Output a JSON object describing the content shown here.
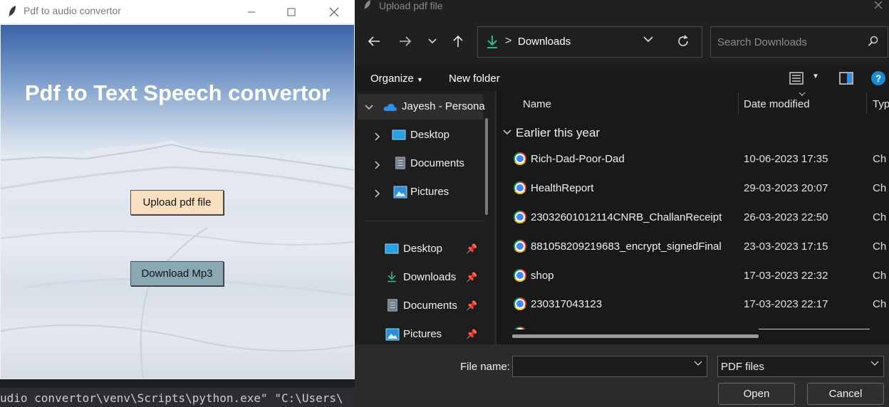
{
  "tk_window": {
    "title": "Pdf to audio convertor",
    "heading": "Pdf to Text Speech convertor",
    "upload_button": "Upload pdf file",
    "download_button": "Download Mp3"
  },
  "terminal": {
    "text": "udio convertor\\venv\\Scripts\\python.exe\" \"C:\\Users\\"
  },
  "dialog": {
    "title": "Upload pdf file",
    "address": {
      "sep": ">",
      "location": "Downloads"
    },
    "search_placeholder": "Search Downloads",
    "toolbar": {
      "organize": "Organize",
      "new_folder": "New folder",
      "help": "?"
    },
    "nav": {
      "account": "Jayesh - Persona",
      "tree": [
        "Desktop",
        "Documents",
        "Pictures"
      ],
      "quick": [
        "Desktop",
        "Downloads",
        "Documents",
        "Pictures"
      ]
    },
    "columns": {
      "name": "Name",
      "date": "Date modified",
      "type": "Typ"
    },
    "group": "Earlier this year",
    "files": [
      {
        "name": "Rich-Dad-Poor-Dad",
        "date": "10-06-2023 17:35",
        "type": "Ch"
      },
      {
        "name": "HealthReport",
        "date": "29-03-2023 20:07",
        "type": "Ch"
      },
      {
        "name": "23032601012114CNRB_ChallanReceipt",
        "date": "26-03-2023 22:50",
        "type": "Ch"
      },
      {
        "name": "881058209219683_encrypt_signedFinal",
        "date": "23-03-2023 17:15",
        "type": "Ch"
      },
      {
        "name": "shop",
        "date": "17-03-2023 22:32",
        "type": "Ch"
      },
      {
        "name": "230317043123",
        "date": "17-03-2023 22:17",
        "type": "Ch"
      }
    ],
    "file_name_label": "File name:",
    "file_name_value": "",
    "filter": "PDF files",
    "open": "Open",
    "cancel": "Cancel"
  }
}
